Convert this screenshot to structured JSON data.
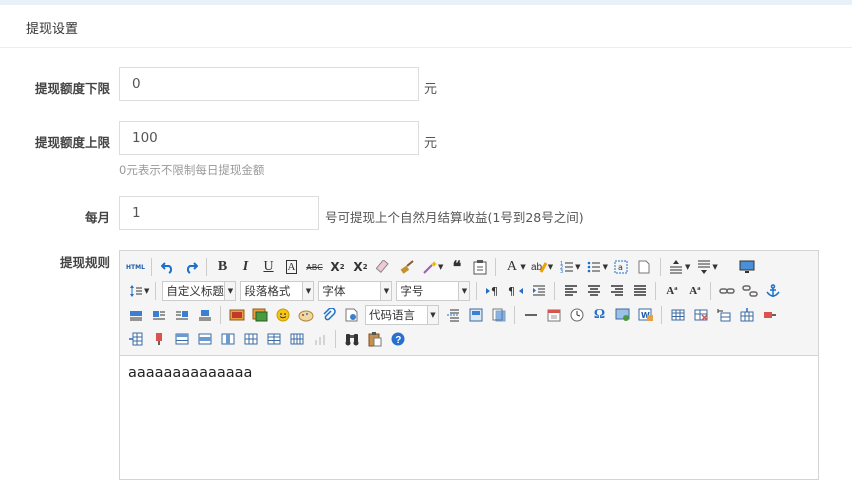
{
  "section": {
    "title": "提现设置"
  },
  "form": {
    "min": {
      "label": "提现额度下限",
      "value": "0",
      "unit": "元"
    },
    "max": {
      "label": "提现额度上限",
      "value": "100",
      "unit": "元",
      "hint": "0元表示不限制每日提现金额"
    },
    "monthly": {
      "label": "每月",
      "value": "1",
      "suffix": "号可提现上个自然月结算收益(1号到28号之间)"
    },
    "rules": {
      "label": "提现规则"
    }
  },
  "editor": {
    "selects": {
      "custom_title": "自定义标题",
      "paragraph": "段落格式",
      "font": "字体",
      "size": "字号",
      "code_lang": "代码语言"
    },
    "html_label": "HTML",
    "content": "aaaaaaaaaaaaaa"
  },
  "colors": {
    "accent": "#1e88d4",
    "border": "#dddddd",
    "topbar": "#e8f1f8"
  }
}
